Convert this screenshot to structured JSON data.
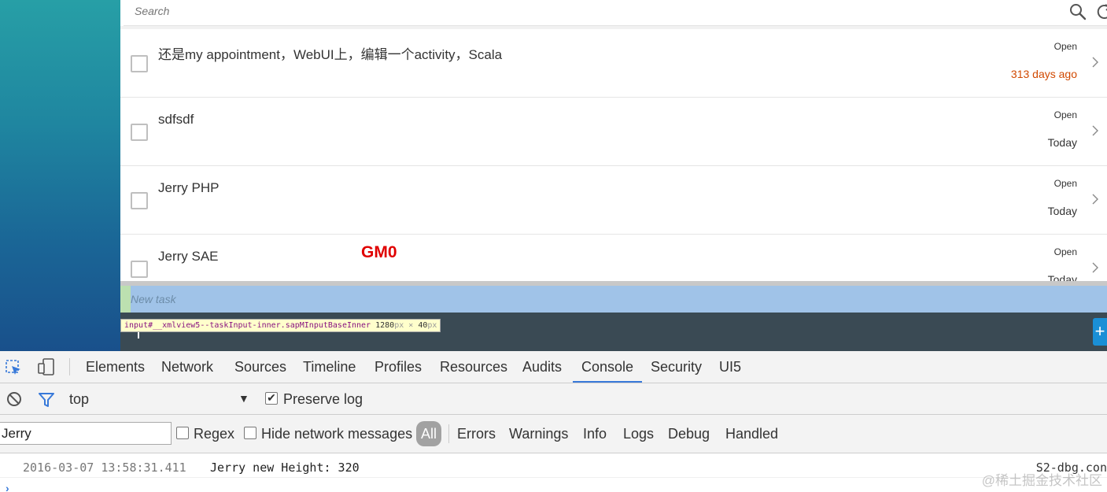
{
  "app": {
    "search_placeholder": "Search",
    "tasks": [
      {
        "title": "还是my appointment，WebUI上，编辑一个activity，Scala",
        "status": "Open",
        "date": "313 days ago",
        "overdue": true
      },
      {
        "title": "sdfsdf",
        "status": "Open",
        "date": "Today",
        "overdue": false
      },
      {
        "title": "Jerry PHP",
        "status": "Open",
        "date": "Today",
        "overdue": false
      },
      {
        "title": "Jerry SAE",
        "status": "Open",
        "date": "Today",
        "overdue": false
      }
    ],
    "overlay_label": "GM0",
    "new_task_placeholder": "New task",
    "add_button_label": "+",
    "inspect_tooltip": {
      "selector": "input#__xmlview5--taskInput-inner.sapMInputBaseInner",
      "width": "1280",
      "height": "40",
      "unit": "px",
      "times": "×"
    }
  },
  "devtools": {
    "tabs": [
      {
        "label": "Elements"
      },
      {
        "label": "Network"
      },
      {
        "label": "Sources"
      },
      {
        "label": "Timeline"
      },
      {
        "label": "Profiles"
      },
      {
        "label": "Resources"
      },
      {
        "label": "Audits"
      },
      {
        "label": "Console",
        "active": true
      },
      {
        "label": "Security"
      },
      {
        "label": "UI5"
      }
    ],
    "toolbar": {
      "context": "top",
      "dropdown_arrow": "▼",
      "preserve_log_label": "Preserve log",
      "preserve_log_checked": true,
      "check_mark": "✔"
    },
    "filter": {
      "value": "Jerry",
      "regex_label": "Regex",
      "hide_network_label": "Hide network messages",
      "levels": [
        {
          "label": "All",
          "active": true
        },
        {
          "label": "Errors"
        },
        {
          "label": "Warnings"
        },
        {
          "label": "Info"
        },
        {
          "label": "Logs"
        },
        {
          "label": "Debug"
        },
        {
          "label": "Handled"
        }
      ]
    },
    "console": {
      "timestamp": "2016-03-07 13:58:31.411",
      "message": "Jerry new Height: 320",
      "source": "S2-dbg.con",
      "prompt": "›"
    }
  },
  "watermark": "@稀土掘金技术社区",
  "colors": {
    "accent": "#3879d9",
    "overdue": "#d14900",
    "overlay_text": "#e00000",
    "highlight": "#a0c3e8"
  }
}
